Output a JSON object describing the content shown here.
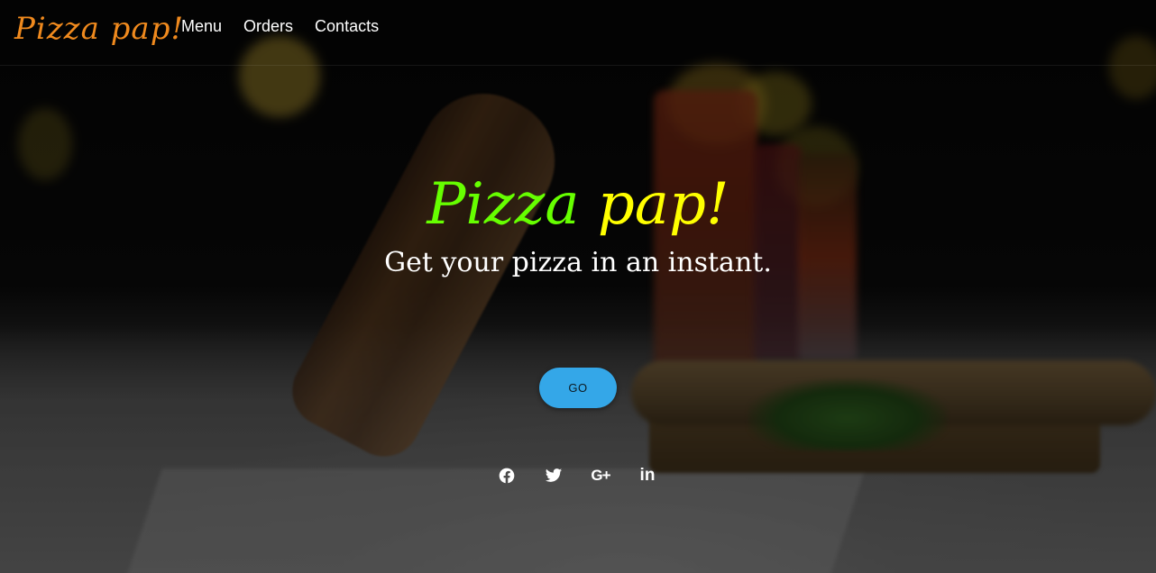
{
  "brand": {
    "logo_text": "Pizza pap!",
    "logo_color": "#f08a1e"
  },
  "nav": {
    "items": [
      {
        "label": "Menu"
      },
      {
        "label": "Orders"
      },
      {
        "label": "Contacts"
      }
    ]
  },
  "hero": {
    "title_word_1": "Pizza",
    "title_word_2": "pap!",
    "title_color_1": "#66ff00",
    "title_color_2": "#ffff00",
    "subtitle": "Get your pizza in an instant.",
    "cta_label": "GO",
    "cta_color": "#34a7e8"
  },
  "social": {
    "icons": [
      "facebook-icon",
      "twitter-icon",
      "google-plus-icon",
      "linkedin-icon"
    ],
    "google_plus_glyph": "G+",
    "linkedin_glyph": "in"
  }
}
